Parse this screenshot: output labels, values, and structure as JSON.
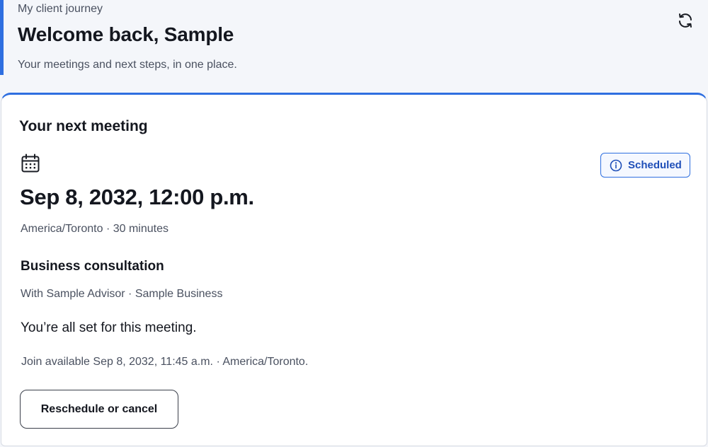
{
  "header": {
    "eyebrow": "My client journey",
    "title": "Welcome back, Sample",
    "subtitle": "Your meetings and next steps, in one place.",
    "refresh_icon": "refresh-icon",
    "accent_color": "#2f6fe0"
  },
  "meeting_card": {
    "title": "Your next meeting",
    "calendar_icon": "calendar-icon",
    "status": {
      "label": "Scheduled",
      "icon": "info-icon",
      "color": "#2f6fe0"
    },
    "datetime": "Sep 8, 2032, 12:00 p.m.",
    "meta": "America/Toronto · 30 minutes",
    "type": "Business consultation",
    "with": "With Sample Advisor · Sample Business",
    "ready_text": "You’re all set for this meeting.",
    "join_text": "Join available Sep 8, 2032, 11:45 a.m. · America/Toronto.",
    "reschedule_label": "Reschedule or cancel"
  }
}
